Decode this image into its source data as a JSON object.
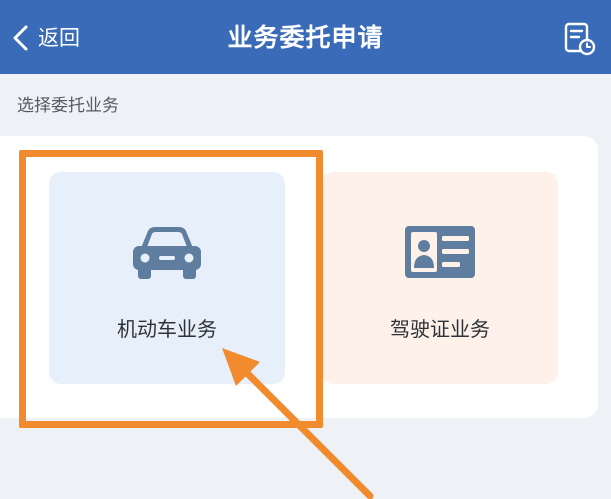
{
  "header": {
    "back_label": "返回",
    "title": "业务委托申请",
    "history_icon": "history-record-icon",
    "color": "#3a6bb8"
  },
  "section": {
    "label": "选择委托业务"
  },
  "cards": [
    {
      "label": "机动车业务",
      "icon": "car-icon",
      "background": "#e7f0fa"
    },
    {
      "label": "驾驶证业务",
      "icon": "id-card-icon",
      "background": "#fdf1ea"
    }
  ],
  "annotation": {
    "highlight_color": "#f28a2e",
    "arrow_color": "#f28a2e"
  }
}
